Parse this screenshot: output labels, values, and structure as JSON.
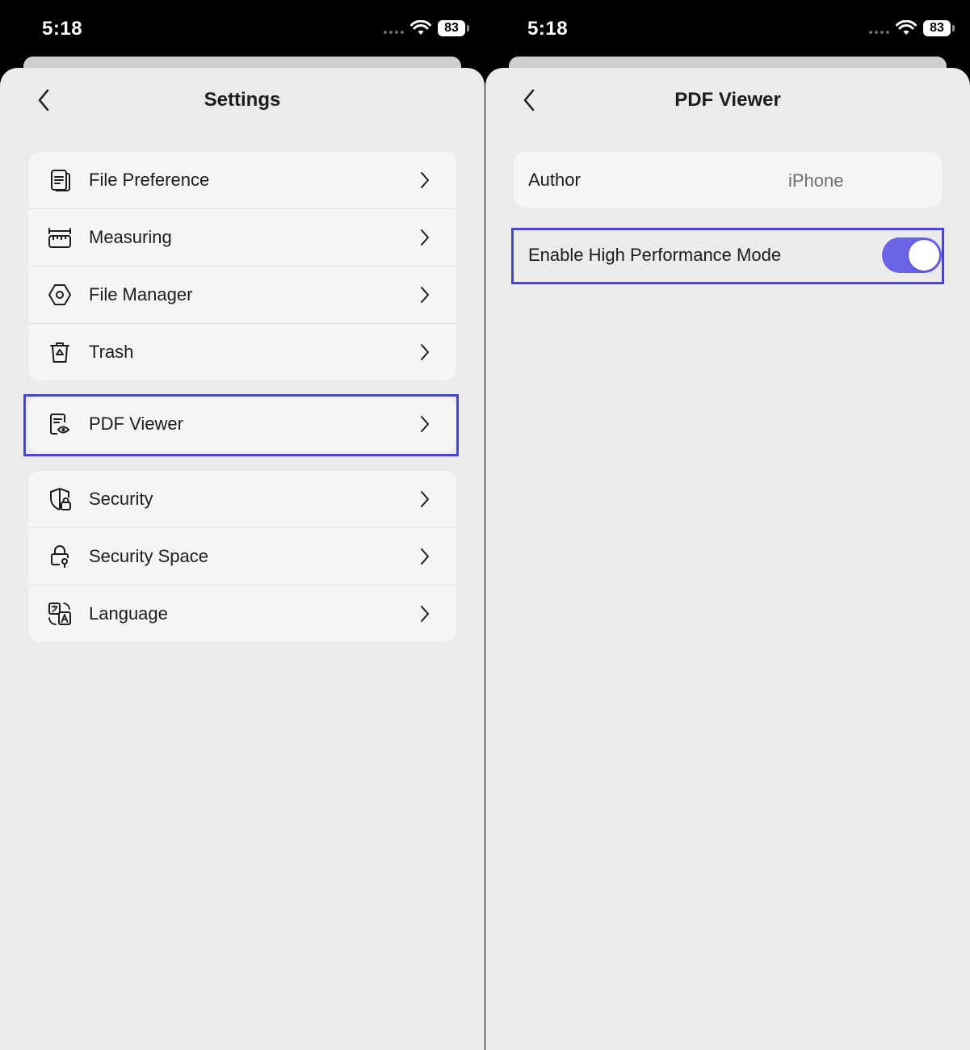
{
  "status_bar": {
    "time": "5:18",
    "battery": "83"
  },
  "settings": {
    "title": "Settings",
    "groups": [
      [
        {
          "label": "File Preference",
          "icon": "file-preference-icon"
        },
        {
          "label": "Measuring",
          "icon": "ruler-icon"
        },
        {
          "label": "File Manager",
          "icon": "hexagon-icon"
        },
        {
          "label": "Trash",
          "icon": "trash-icon"
        }
      ],
      [
        {
          "label": "PDF Viewer",
          "icon": "pdf-viewer-icon"
        }
      ],
      [
        {
          "label": "Security",
          "icon": "shield-lock-icon"
        },
        {
          "label": "Security Space",
          "icon": "lock-key-icon"
        },
        {
          "label": "Language",
          "icon": "language-icon"
        }
      ]
    ]
  },
  "pdf_viewer": {
    "title": "PDF Viewer",
    "author_label": "Author",
    "author_value": "iPhone",
    "high_performance_label": "Enable High Performance Mode",
    "high_performance_enabled": true
  },
  "colors": {
    "accent": "#6c63e8",
    "highlight": "#4a46c9",
    "background": "#ebebeb",
    "card": "#f5f5f5"
  }
}
